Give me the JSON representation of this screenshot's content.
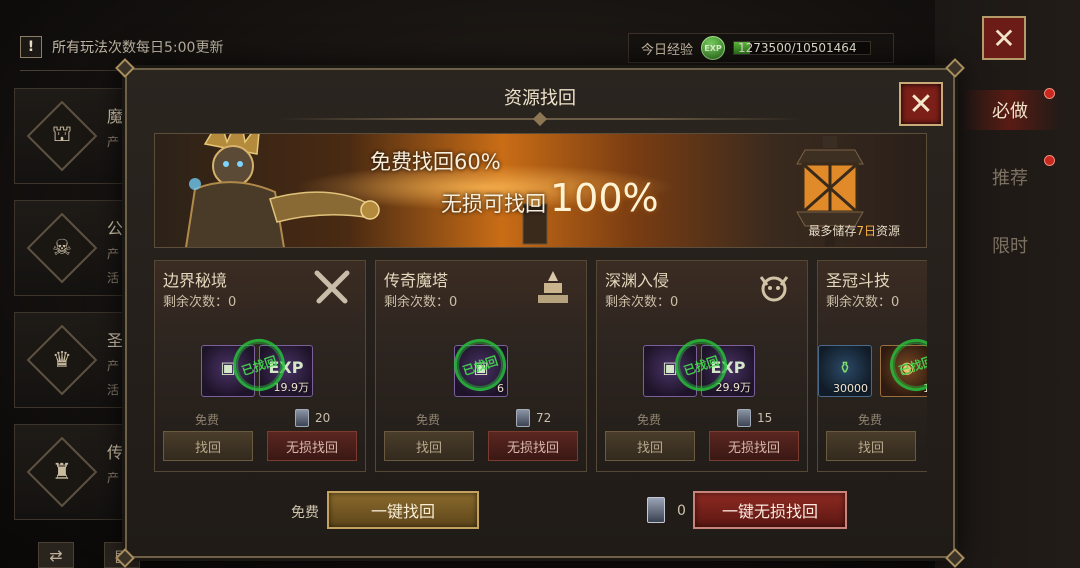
{
  "background": {
    "notice": "所有玩法次数每日5:00更新",
    "exp": {
      "label": "今日经验",
      "badge": "EXP",
      "value": "1273500/10501464",
      "progress": 0.121
    },
    "side_cards": [
      {
        "title": "魔",
        "sub1": "产",
        "sub2": ""
      },
      {
        "title": "公",
        "sub1": "产",
        "sub2": "活"
      },
      {
        "title": "圣",
        "sub1": "产",
        "sub2": "活"
      },
      {
        "title": "传",
        "sub1": "产",
        "sub2": ""
      }
    ],
    "right_tabs": [
      "必做",
      "推荐",
      "限时"
    ],
    "close_glyph": "✕"
  },
  "modal": {
    "title": "资源找回",
    "close_glyph": "✕",
    "banner": {
      "line1": "免费找回60%",
      "line2_prefix": "无损可找回",
      "line2_big": "100%",
      "note_prefix": "最多储存",
      "note_days": "7日",
      "note_suffix": "资源"
    },
    "cards": [
      {
        "title": "边界秘境",
        "remaining": "剩余次数：0",
        "emblem": "crossed-swords-icon",
        "items": [
          {
            "kind": "chest",
            "qty": ""
          },
          {
            "kind": "exp",
            "glyph": "EXP",
            "qty": "19.9万"
          }
        ],
        "free_label": "免费",
        "cost": "20",
        "btn_free": "找回",
        "btn_lossless": "无损找回"
      },
      {
        "title": "传奇魔塔",
        "remaining": "剩余次数：0",
        "emblem": "altar-icon",
        "items": [
          {
            "kind": "chest",
            "qty": "6"
          }
        ],
        "free_label": "免费",
        "cost": "72",
        "btn_free": "找回",
        "btn_lossless": "无损找回"
      },
      {
        "title": "深渊入侵",
        "remaining": "剩余次数：0",
        "emblem": "demon-skull-icon",
        "items": [
          {
            "kind": "chest",
            "qty": ""
          },
          {
            "kind": "exp",
            "glyph": "EXP",
            "qty": "29.9万"
          }
        ],
        "free_label": "免费",
        "cost": "15",
        "btn_free": "找回",
        "btn_lossless": "无损找回"
      },
      {
        "title": "圣冠斗技",
        "remaining": "剩余次数：0",
        "emblem": "",
        "items": [
          {
            "kind": "potion",
            "qty": "30000"
          },
          {
            "kind": "orb",
            "qty": "1"
          }
        ],
        "free_label": "免费",
        "cost": "",
        "btn_free": "找回",
        "btn_lossless": ""
      }
    ],
    "footer": {
      "free_label": "免费",
      "btn_onekey": "一键找回",
      "cost": "0",
      "btn_lossless": "一键无损找回"
    }
  },
  "colors": {
    "accent_gold": "#c3a25f",
    "accent_red": "#8d2a22",
    "stamp_green": "#28be3c"
  }
}
